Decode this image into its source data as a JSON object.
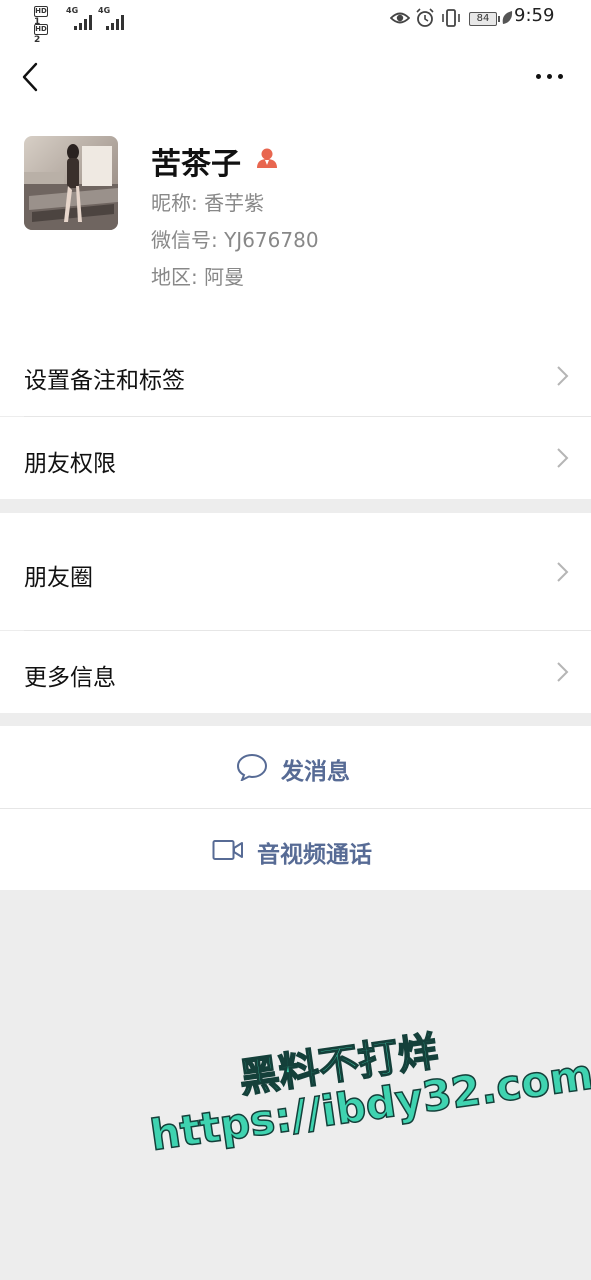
{
  "status_bar": {
    "sim1": "HD",
    "sim1_sub": "1",
    "sim2": "HD",
    "sim2_sub": "2",
    "net1": "4G",
    "net2": "4G",
    "battery": "84",
    "time": "9:59"
  },
  "nav": {
    "back_icon": "chevron-left-icon",
    "more_icon": "more-dots-icon"
  },
  "profile": {
    "name": "苦茶子",
    "gender_icon": "female-user-icon",
    "nickname": "昵称:  香芋紫",
    "wechat_id": "微信号:  YJ676780",
    "region": "地区:  阿曼"
  },
  "menu": {
    "remark_tags": "设置备注和标签",
    "friend_permissions": "朋友权限",
    "moments": "朋友圈",
    "more_info": "更多信息"
  },
  "actions": {
    "send_message": "发消息",
    "video_call": "音视频通话"
  },
  "watermark": {
    "line1": "黑料不打烊",
    "line2": "https://ibdy32.com"
  },
  "colors": {
    "link_blue": "#576b95",
    "background": "#ededed",
    "watermark_fill": "#3fd3b0"
  }
}
